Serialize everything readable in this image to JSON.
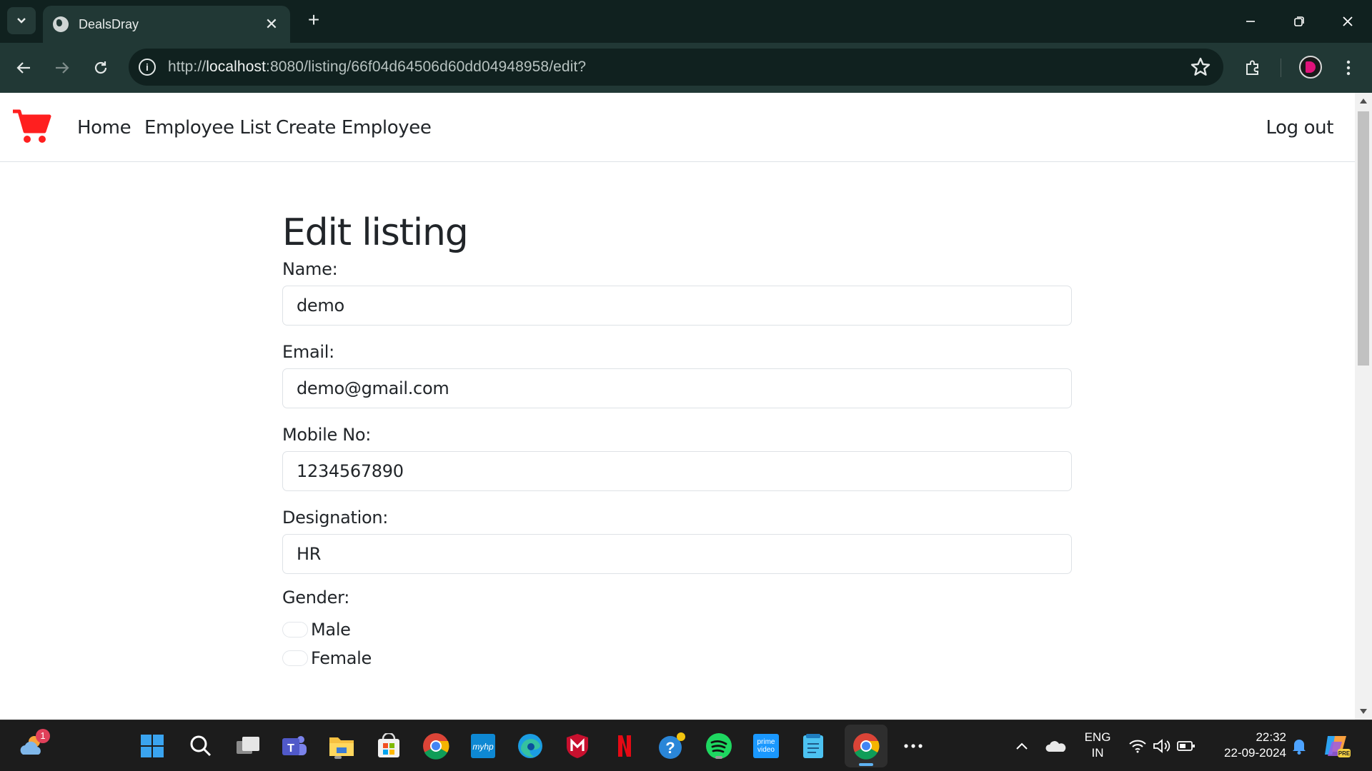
{
  "browser": {
    "tab_title": "DealsDray",
    "url_prefix": "http://",
    "url_host": "localhost",
    "url_rest": ":8080/listing/66f04d64506d60dd04948958/edit?"
  },
  "navbar": {
    "home": "Home",
    "employee_list": "Employee List",
    "create_employee": "Create Employee",
    "logout": "Log out",
    "brand_color": "#ff1f1f"
  },
  "form": {
    "title": "Edit listing",
    "name_label": "Name:",
    "name_value": "demo",
    "email_label": "Email:",
    "email_value": "demo@gmail.com",
    "mobile_label": "Mobile No:",
    "mobile_value": "1234567890",
    "designation_label": "Designation:",
    "designation_value": "HR",
    "gender_label": "Gender:",
    "gender_options": [
      "Male",
      "Female"
    ]
  },
  "taskbar": {
    "weather_badge": "1",
    "lang_line1": "ENG",
    "lang_line2": "IN",
    "time": "22:32",
    "date": "22-09-2024"
  }
}
